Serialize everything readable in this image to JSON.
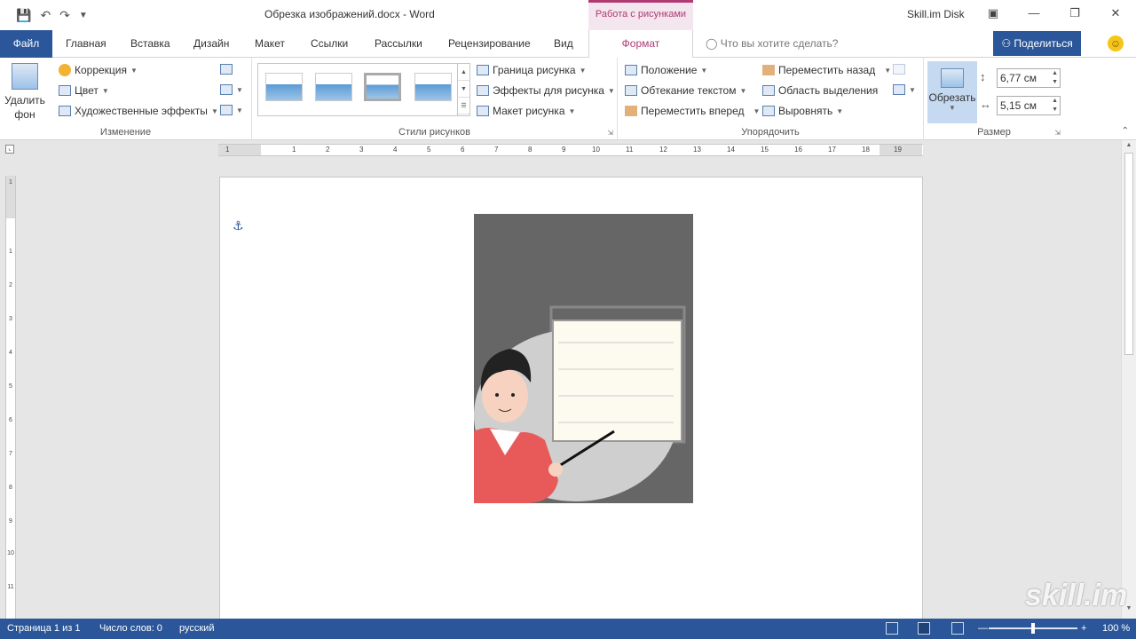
{
  "titlebar": {
    "document_title": "Обрезка изображений.docx  -  Word",
    "contextual_tab": "Работа с рисунками",
    "account": "Skill.im Disk",
    "qat": {
      "save_icon": "save-icon",
      "undo_icon": "undo-icon",
      "redo_icon": "redo-icon",
      "customize_icon": "customize-qat-icon"
    }
  },
  "tabs": {
    "file": "Файл",
    "items": [
      "Главная",
      "Вставка",
      "Дизайн",
      "Макет",
      "Ссылки",
      "Рассылки",
      "Рецензирование",
      "Вид"
    ],
    "active": "Формат",
    "tell_me": "Что вы хотите сделать?",
    "share": "Поделиться"
  },
  "ribbon": {
    "adjust": {
      "label": "Изменение",
      "remove_bg_line1": "Удалить",
      "remove_bg_line2": "фон",
      "corrections": "Коррекция",
      "color": "Цвет",
      "artistic": "Художественные эффекты"
    },
    "styles": {
      "label": "Стили рисунков",
      "border": "Граница рисунка",
      "effects": "Эффекты для рисунка",
      "layout": "Макет рисунка"
    },
    "arrange": {
      "label": "Упорядочить",
      "position": "Положение",
      "wrap": "Обтекание текстом",
      "forward": "Переместить вперед",
      "backward": "Переместить назад",
      "selection_pane": "Область выделения",
      "align": "Выровнять"
    },
    "size": {
      "label": "Размер",
      "crop": "Обрезать",
      "height": "6,77 см",
      "width": "5,15 см"
    }
  },
  "ruler": {
    "h_ticks": [
      "1",
      "1",
      "2",
      "3",
      "4",
      "5",
      "6",
      "7",
      "8",
      "9",
      "10",
      "11",
      "12",
      "13",
      "14",
      "15",
      "16",
      "17",
      "18",
      "19"
    ],
    "v_ticks": [
      "1",
      "1",
      "2",
      "3",
      "4",
      "5",
      "6",
      "7",
      "8",
      "9",
      "10",
      "11"
    ]
  },
  "statusbar": {
    "page": "Страница 1 из 1",
    "words": "Число слов: 0",
    "language": "русский",
    "zoom": "100 %"
  },
  "watermark": "skill.im",
  "colors": {
    "accent": "#2b579a",
    "contextual": "#b03a73"
  }
}
